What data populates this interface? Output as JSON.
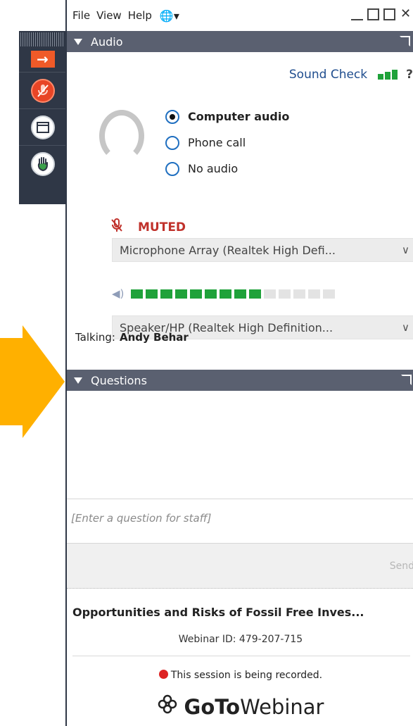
{
  "menu": {
    "items": [
      "File",
      "View",
      "Help"
    ],
    "globe_glyph": "🌐",
    "dropdown_glyph": "▾"
  },
  "window": {
    "minimize_glyph": "_",
    "maximize_glyph": "☐",
    "restore_glyph": "⧉",
    "close_glyph": "✕"
  },
  "audio": {
    "header": "Audio",
    "sound_check": "Sound Check",
    "help_glyph": "?",
    "signal_levels": [
      0.55,
      0.8,
      1.0
    ],
    "options": [
      {
        "label": "Computer audio",
        "selected": true
      },
      {
        "label": "Phone call",
        "selected": false
      },
      {
        "label": "No audio",
        "selected": false
      }
    ],
    "muted_label": "MUTED",
    "microphone": "Microphone Array (Realtek High Defi...",
    "speaker": "Speaker/HP (Realtek High Definition...",
    "volume_level": 9,
    "volume_total": 14,
    "talking_label": "Talking:",
    "talking_name": "Andy Behar"
  },
  "questions": {
    "header": "Questions",
    "placeholder": "[Enter a question for staff]",
    "send_label": "Send"
  },
  "webinar": {
    "title": "Opportunities and Risks of Fossil Free Inves...",
    "id_line": "Webinar ID: 479-207-715",
    "recording_text": "This session is being recorded.",
    "logo_part1": "GoTo",
    "logo_part2": "Webinar"
  },
  "grab_tab": {
    "icons": [
      "arrow-right-icon",
      "mic-muted-icon",
      "window-icon",
      "raise-hand-icon"
    ]
  },
  "colors": {
    "header_bg": "#5a6070",
    "grab_bg": "#2f3746",
    "accent_orange": "#f05a28",
    "muted_red": "#c0312b",
    "meter_green": "#1fa23a",
    "link_blue": "#1f4d8e",
    "arrow_yellow": "#ffb000"
  }
}
